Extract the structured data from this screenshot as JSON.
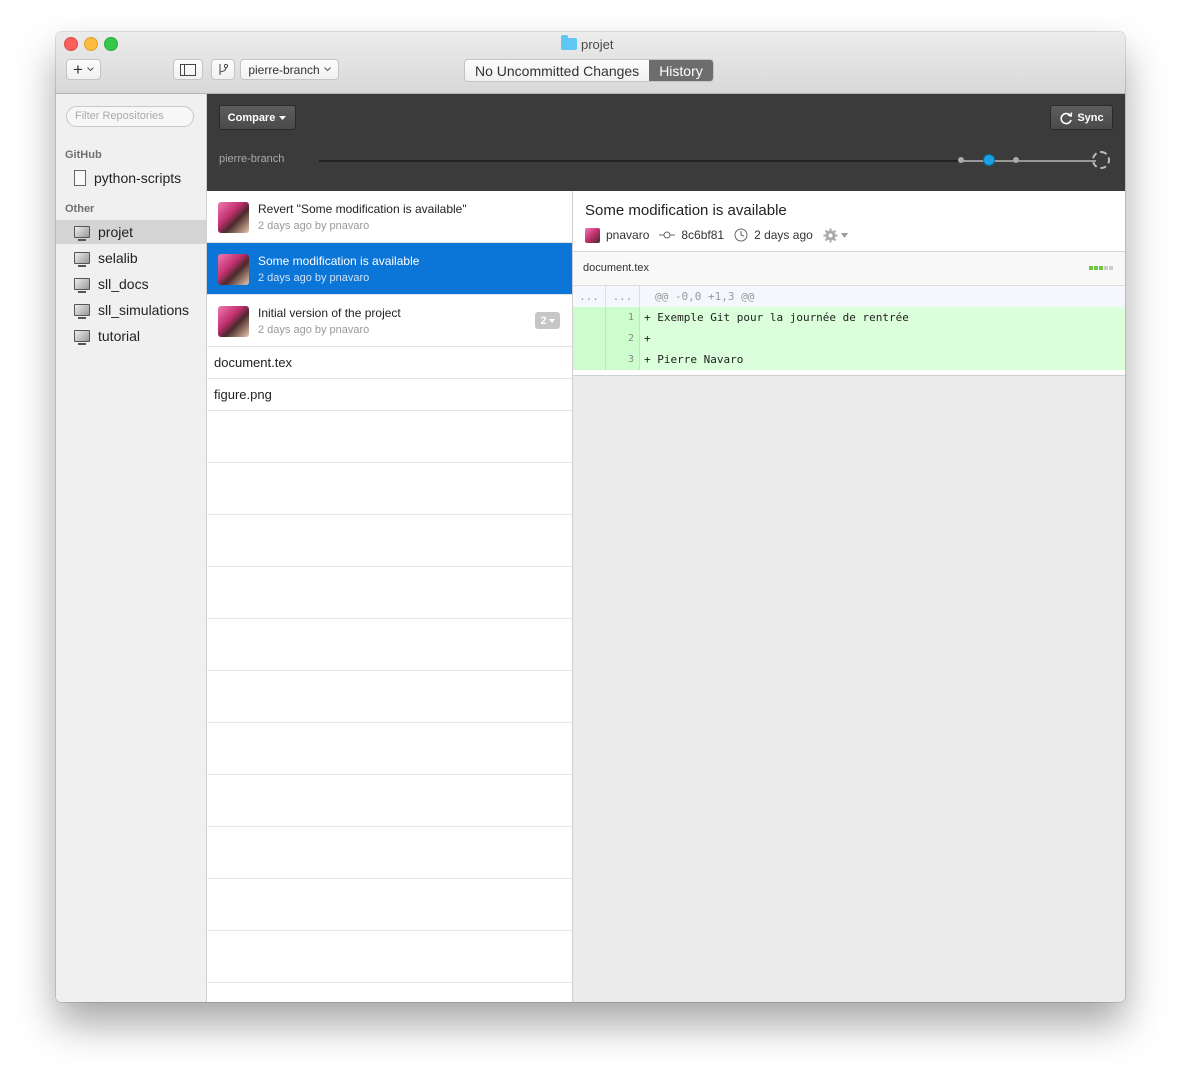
{
  "window": {
    "title": "projet"
  },
  "toolbar": {
    "add_label": "+",
    "branch_label": "pierre-branch",
    "tabs": [
      {
        "label": "No Uncommitted Changes",
        "active": false
      },
      {
        "label": "History",
        "active": true
      }
    ]
  },
  "sidebar": {
    "filter_placeholder": "Filter Repositories",
    "sections": [
      {
        "header": "GitHub",
        "items": [
          {
            "label": "python-scripts",
            "icon": "repo-book-icon",
            "selected": false
          }
        ]
      },
      {
        "header": "Other",
        "items": [
          {
            "label": "projet",
            "icon": "monitor-icon",
            "selected": true
          },
          {
            "label": "selalib",
            "icon": "monitor-icon",
            "selected": false
          },
          {
            "label": "sll_docs",
            "icon": "monitor-icon",
            "selected": false
          },
          {
            "label": "sll_simulations",
            "icon": "monitor-icon",
            "selected": false
          },
          {
            "label": "tutorial",
            "icon": "monitor-icon",
            "selected": false
          }
        ]
      }
    ]
  },
  "history_bar": {
    "compare_label": "Compare",
    "sync_label": "Sync",
    "branch_name": "pierre-branch"
  },
  "commits": [
    {
      "title": "Revert \"Some modification is available\"",
      "subtitle": "2 days ago by pnavaro",
      "selected": false
    },
    {
      "title": "Some modification is available",
      "subtitle": "2 days ago by pnavaro",
      "selected": true
    },
    {
      "title": "Initial version of the project",
      "subtitle": "2 days ago by pnavaro",
      "selected": false,
      "badge": "2"
    }
  ],
  "files": [
    "document.tex",
    "figure.png"
  ],
  "detail": {
    "title": "Some modification is available",
    "author": "pnavaro",
    "sha": "8c6bf81",
    "time": "2 days ago",
    "file_name": "document.tex",
    "hunk_left": "...",
    "hunk_right": "...",
    "hunk_header": "@@ -0,0 +1,3 @@",
    "lines": [
      {
        "num": "1",
        "code": "+ Exemple Git pour la journée de rentrée"
      },
      {
        "num": "2",
        "code": "+"
      },
      {
        "num": "3",
        "code": "+ Pierre Navaro"
      }
    ]
  },
  "colors": {
    "selection": "#0b75d8",
    "added_bg": "#dbffdb",
    "timeline_dot": "#1aa0e0"
  }
}
